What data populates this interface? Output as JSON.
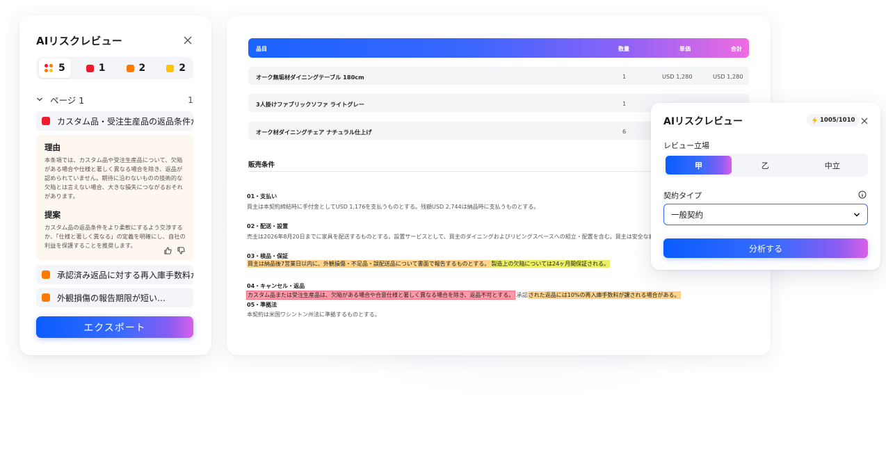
{
  "left_panel": {
    "title": "AIリスクレビュー",
    "counts": {
      "total": "5",
      "red": "1",
      "orange": "2",
      "yellow": "2"
    },
    "page_label": "ページ 1",
    "page_count": "1",
    "issues": [
      {
        "label": "カスタム品・受注生産品の返品条件が厳…",
        "color": "#f0192e"
      },
      {
        "label": "承認済み返品に対する再入庫手数料が…",
        "color": "#ff7a00"
      },
      {
        "label": "外観損傷の報告期限が短い…",
        "color": "#ff7a00"
      }
    ],
    "detail": {
      "reason_title": "理由",
      "reason_text": "本条項では、カスタム品や受注生産品について、欠陥がある場合や仕様と著しく異なる場合を除き、返品が認められていません。期待に沿わないものの技術的な欠陥とは言えない場合、大きな損失につながるおそれがあります。",
      "proposal_title": "提案",
      "proposal_text": "カスタム品の返品条件をより柔軟にするよう交渉するか、「仕様と著しく異なる」の定義を明確にし、自社の利益を保護することを推奨します。"
    },
    "export_label": "エクスポート"
  },
  "table": {
    "headers": {
      "item": "品目",
      "qty": "数量",
      "unit": "単価",
      "total": "合計"
    },
    "rows": [
      {
        "item": "オーク無垢材ダイニングテーブル 180cm",
        "qty": "1",
        "unit": "USD 1,280",
        "total": "USD 1,280"
      },
      {
        "item": "3人掛けファブリックソファ ライトグレー",
        "qty": "1",
        "unit": "",
        "total": ""
      },
      {
        "item": "オーク材ダイニングチェア ナチュラル仕上げ",
        "qty": "6",
        "unit": "",
        "total": ""
      }
    ]
  },
  "document": {
    "section_title": "販売条件",
    "c1_head": "01・支払い",
    "c1_text": "買主は本契約締結時に手付金としてUSD 1,176を支払うものとする。残額USD 2,744は納品時に支払うものとする。",
    "c2_head": "02・配送・設置",
    "c2_text": "売主は2026年8月20日までに家具を配送するものとする。設置サービスとして、買主のダイニングおよびリビングスペースへの組立・配置を含む。買主は安全な搬入経路を確保するものとする。",
    "c3_head": "03・検品・保証",
    "c3_hl1": "買主は納品後7営業日以内に、外観損傷・不足品・誤配送品について書面で報告するものとする。",
    "c3_hl2": "製造上の欠陥については24ヶ月間保証される。",
    "c4_head": "04・キャンセル・返品",
    "c4_hl_red": "カスタム品または受注生産品は、欠陥がある場合や合意仕様と著しく異なる場合を除き、返品不可とする。",
    "c4_mid": "承認",
    "c4_hl_orange": "された返品には10%の再入庫手数料が課される場合がある。",
    "c5_head": "05・準拠法",
    "c5_text": "本契約は米国ワシントン州法に準拠するものとする。"
  },
  "popup": {
    "title": "AIリスクレビュー",
    "credits": "1005/1010",
    "stance_label": "レビュー立場",
    "stance_options": [
      "甲",
      "乙",
      "中立"
    ],
    "type_label": "契約タイプ",
    "type_value": "一般契約",
    "analyze_label": "分析する"
  },
  "colors": {
    "accent": "#1b63ff",
    "red": "#f0192e",
    "orange": "#ff7a00",
    "yellow": "#ffc400",
    "gradient_end": "#d860ea"
  }
}
